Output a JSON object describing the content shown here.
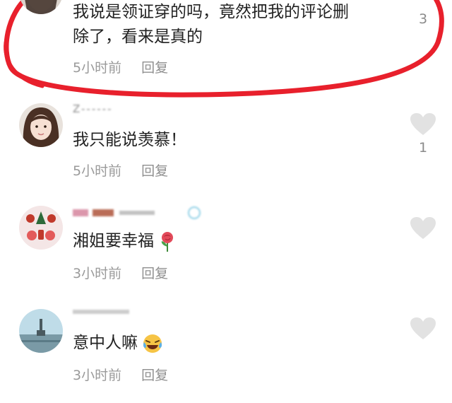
{
  "comments": [
    {
      "text_lines": [
        "我说是领证穿的吗，竟然把我的评论删",
        "除了，看来是真的"
      ],
      "time": "5小时前",
      "reply": "回复",
      "likes": "3"
    },
    {
      "username": "Z------",
      "text": "我只能说羡慕！",
      "time": "5小时前",
      "reply": "回复",
      "likes": "1"
    },
    {
      "text": "湘姐要幸福",
      "emoji": "rose-icon",
      "time": "3小时前",
      "reply": "回复"
    },
    {
      "text": "意中人嘛",
      "emoji": "laughing-crying-icon",
      "time": "3小时前",
      "reply": "回复"
    }
  ],
  "colors": {
    "annotation": "#e8202c",
    "heart": "#e2e2e2",
    "meta": "#9a9a9a"
  }
}
